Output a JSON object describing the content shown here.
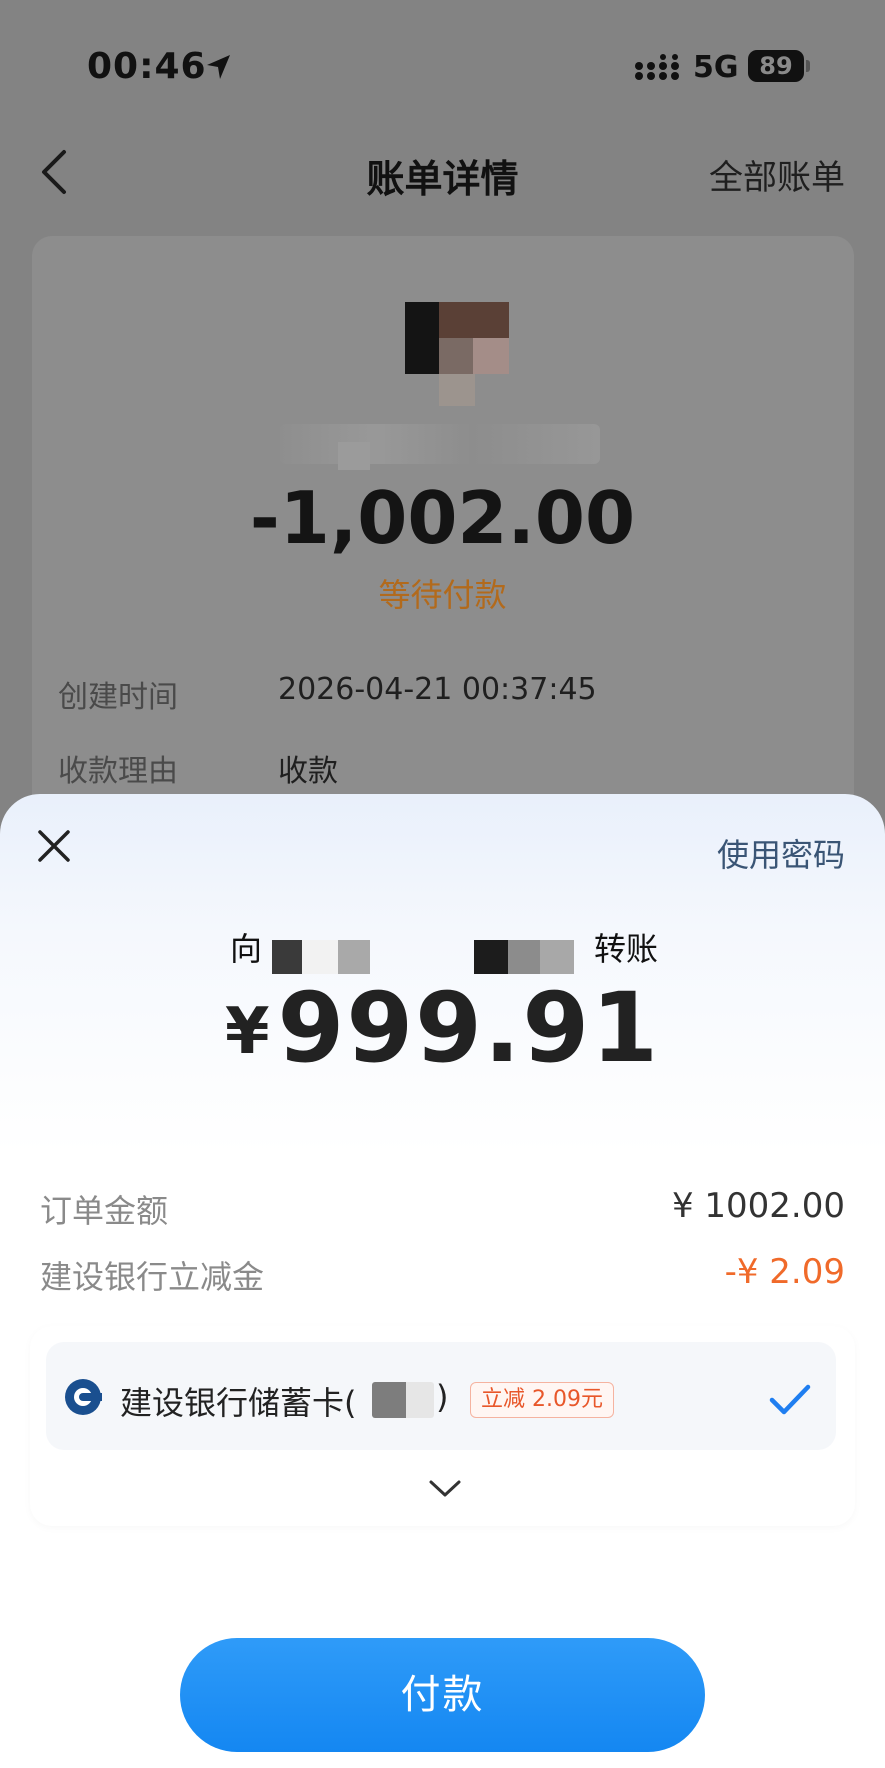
{
  "status_bar": {
    "time": "00:46",
    "network": "5G",
    "battery": "89"
  },
  "nav": {
    "title": "账单详情",
    "right_link": "全部账单"
  },
  "bill": {
    "amount": "-1,002.00",
    "status": "等待付款",
    "status_color": "#b26a1c",
    "rows": [
      {
        "label": "创建时间",
        "value": "2026-04-21 00:37:45"
      },
      {
        "label": "收款理由",
        "value": "收款"
      }
    ]
  },
  "sheet": {
    "use_password": "使用密码",
    "transfer_prefix": "向",
    "transfer_suffix": "转账",
    "currency": "¥",
    "amount": "999.91",
    "rows": [
      {
        "label": "订单金额",
        "value": "¥ 1002.00"
      },
      {
        "label": "建设银行立减金",
        "value": "-¥ 2.09"
      }
    ],
    "discount_color": "#f06a2a",
    "card": {
      "name": "建设银行储蓄卡(",
      "name_close": ")",
      "promo": "立减 2.09元",
      "bank_icon": "ccb-logo-icon"
    },
    "pay_button": "付款",
    "accent_color": "#1487f2"
  }
}
